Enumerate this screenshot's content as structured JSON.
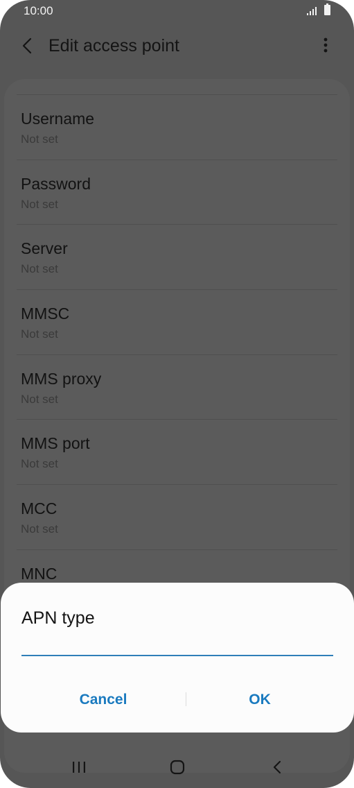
{
  "status_bar": {
    "time": "10:00"
  },
  "app_bar": {
    "title": "Edit access point"
  },
  "settings": [
    {
      "title": "Username",
      "value": "Not set"
    },
    {
      "title": "Password",
      "value": "Not set"
    },
    {
      "title": "Server",
      "value": "Not set"
    },
    {
      "title": "MMSC",
      "value": "Not set"
    },
    {
      "title": "MMS proxy",
      "value": "Not set"
    },
    {
      "title": "MMS port",
      "value": "Not set"
    },
    {
      "title": "MCC",
      "value": "Not set"
    },
    {
      "title": "MNC",
      "value": ""
    }
  ],
  "dialog": {
    "title": "APN type",
    "input_value": "",
    "cancel_label": "Cancel",
    "ok_label": "OK"
  },
  "icons": {
    "back": "chevron-left-icon",
    "more": "more-vertical-icon",
    "signal": "signal-icon",
    "battery": "battery-icon",
    "nav_recents": "recents-icon",
    "nav_home": "home-icon",
    "nav_back": "back-nav-icon"
  },
  "colors": {
    "accent": "#1a7abf",
    "scrim_background": "#565656",
    "dialog_background": "#fcfcfc"
  }
}
